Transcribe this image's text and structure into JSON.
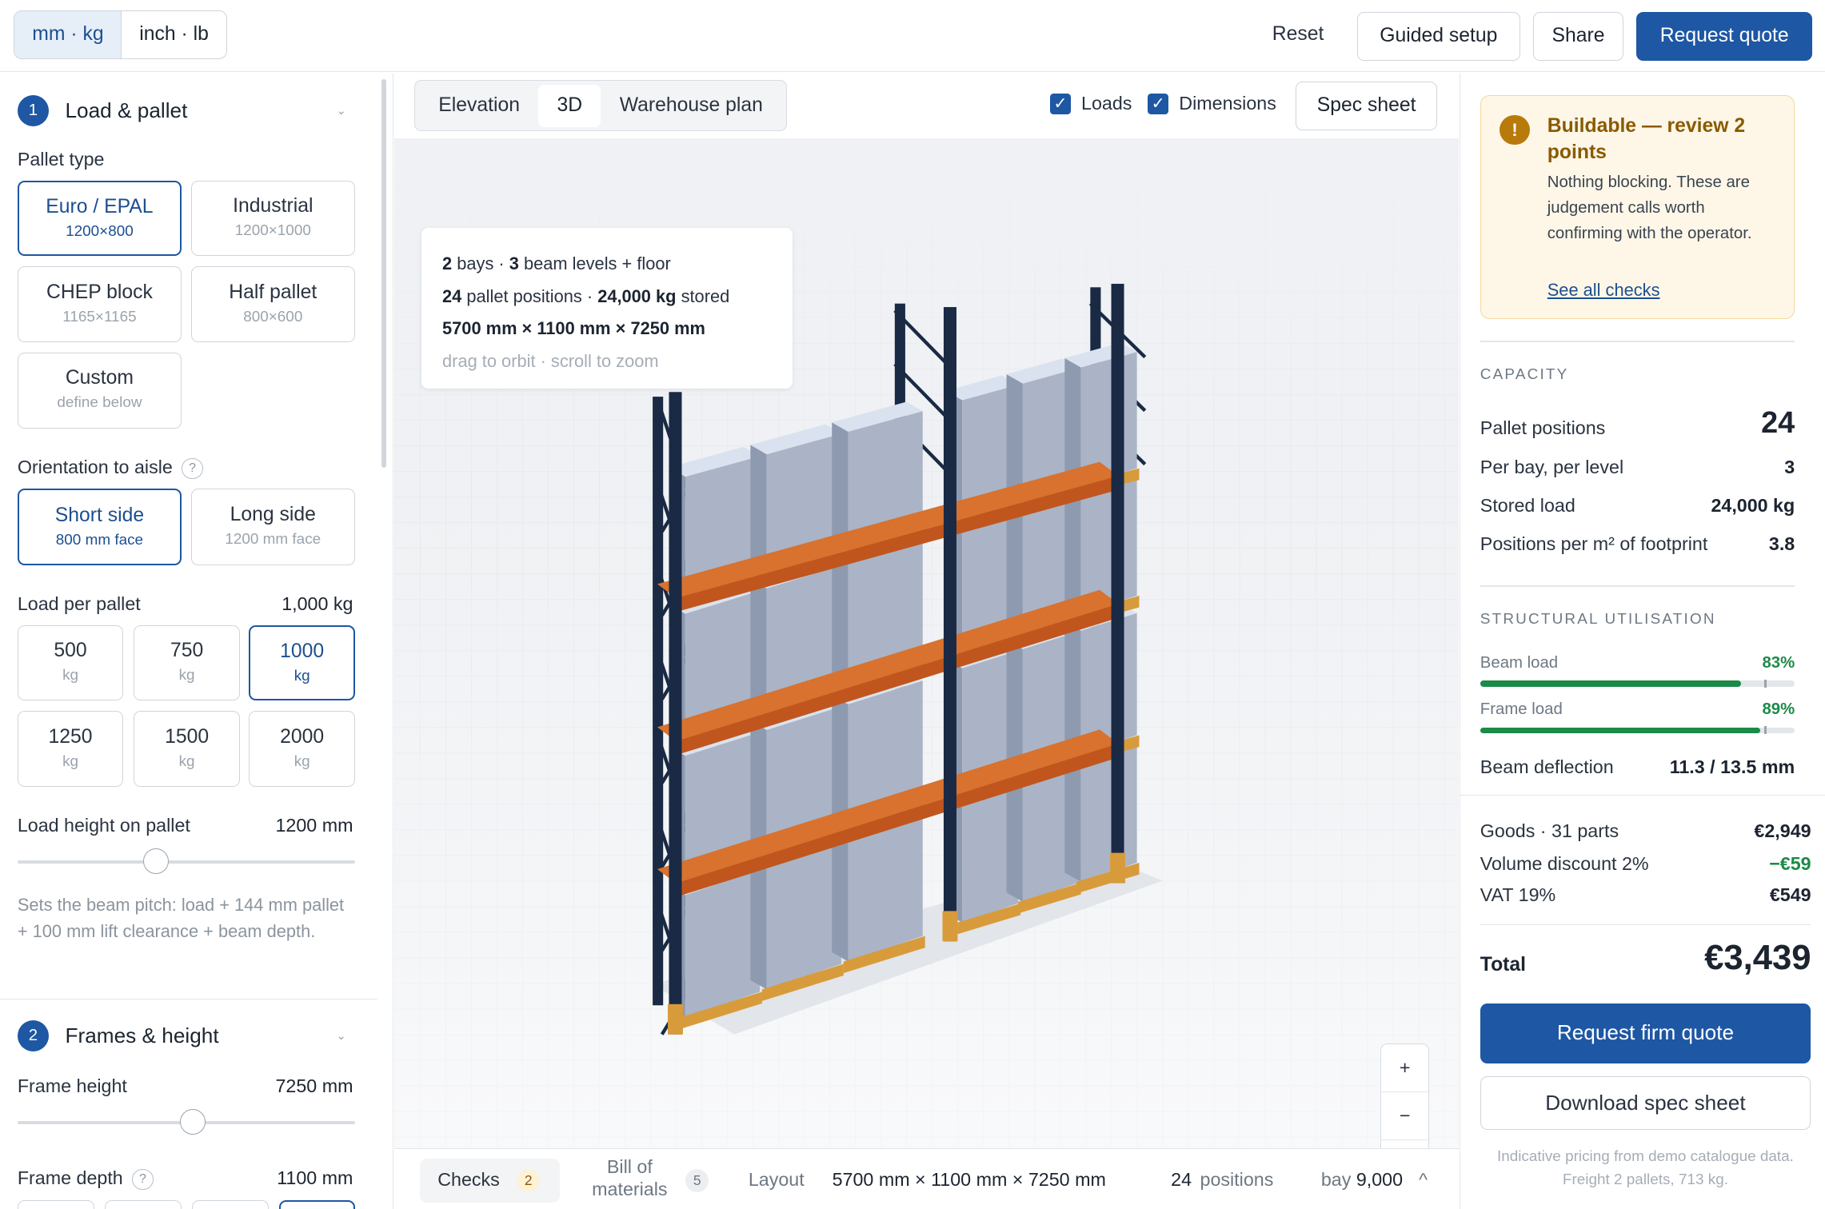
{
  "topbar": {
    "units": [
      "mm · kg",
      "inch · lb"
    ],
    "reset": "Reset",
    "guided": "Guided setup",
    "share": "Share",
    "quote": "Request quote"
  },
  "left": {
    "sec1": {
      "num": "1",
      "title": "Load & pallet"
    },
    "pallet_type_label": "Pallet type",
    "pallets": [
      {
        "title": "Euro / EPAL",
        "sub": "1200×800",
        "selected": true
      },
      {
        "title": "Industrial",
        "sub": "1200×1000"
      },
      {
        "title": "CHEP block",
        "sub": "1165×1165"
      },
      {
        "title": "Half pallet",
        "sub": "800×600"
      },
      {
        "title": "Custom",
        "sub": "define below"
      }
    ],
    "orientation_label": "Orientation to aisle",
    "help": "?",
    "orientations": [
      {
        "title": "Short side",
        "sub": "800 mm face",
        "selected": true
      },
      {
        "title": "Long side",
        "sub": "1200 mm face"
      }
    ],
    "load_label": "Load per pallet",
    "load_value": "1,000 kg",
    "loads": [
      {
        "v": "500",
        "u": "kg"
      },
      {
        "v": "750",
        "u": "kg"
      },
      {
        "v": "1000",
        "u": "kg",
        "selected": true
      },
      {
        "v": "1250",
        "u": "kg"
      },
      {
        "v": "1500",
        "u": "kg"
      },
      {
        "v": "2000",
        "u": "kg"
      }
    ],
    "height_label": "Load height on pallet",
    "height_value": "1200 mm",
    "height_slider": 0.41,
    "note": "Sets the beam pitch: load + 144 mm pallet + 100 mm lift clearance + beam depth.",
    "sec2": {
      "num": "2",
      "title": "Frames & height"
    },
    "frame_height_label": "Frame height",
    "frame_height_value": "7250 mm",
    "frame_slider": 0.52,
    "frame_depth_label": "Frame depth",
    "frame_depth_value": "1100 mm"
  },
  "center": {
    "views": [
      "Elevation",
      "3D",
      "Warehouse plan"
    ],
    "loads_check": "Loads",
    "dims_check": "Dimensions",
    "spec": "Spec sheet",
    "info": {
      "l1a": "2",
      "l1b": "bays · ",
      "l1c": "3",
      "l1d": "beam levels + floor",
      "l2a": "24",
      "l2b": "pallet positions · ",
      "l2c": "24,000 kg",
      "l2d": "stored",
      "l3": "5700 mm × 1100 mm × 7250 mm",
      "l4": "drag to orbit · scroll to zoom"
    },
    "zoom": [
      "+",
      "−",
      "⤢"
    ],
    "bottom": {
      "checks": "Checks",
      "checks_count": "2",
      "bom": "Bill of materials",
      "bom_count": "5",
      "layout": "Layout",
      "layout_dims": "5700 mm × 1100 mm × 7250 mm",
      "positions_n": "24",
      "positions": "positions",
      "bay": "bay",
      "bay_v": "9,000",
      "chevron": "^"
    }
  },
  "right": {
    "warn_icon": "!",
    "warn_title": "Buildable — review 2 points",
    "warn_body": "Nothing blocking. These are judgement calls worth confirming with the operator.",
    "warn_link": "See all checks",
    "capacity": "CAPACITY",
    "cap_rows": [
      {
        "l": "Pallet positions",
        "v": "24"
      },
      {
        "l": "Per bay, per level",
        "v": "3"
      },
      {
        "l": "Stored load",
        "v": "24,000 kg"
      },
      {
        "l": "Positions per m² of footprint",
        "v": "3.8"
      }
    ],
    "structural": "STRUCTURAL UTILISATION",
    "beam_load": "Beam load",
    "beam_pct": "83%",
    "beam_frac": 0.83,
    "frame_load": "Frame load",
    "frame_pct": "89%",
    "frame_frac": 0.89,
    "deflection_l": "Beam deflection",
    "deflection_v": "11.3 / 13.5 mm",
    "goods_l": "Goods · 31 parts",
    "goods_v": "€2,949",
    "disc_l": "Volume discount 2%",
    "disc_v": "−€59",
    "vat_l": "VAT 19%",
    "vat_v": "€549",
    "total_l": "Total",
    "total_v": "€3,439",
    "firm_quote": "Request firm quote",
    "download": "Download spec sheet",
    "footer": "Indicative pricing from demo catalogue data. Freight 2 pallets, 713 kg."
  },
  "colors": {
    "accent": "#1e57a3",
    "upright": "#1a2a44",
    "beam": "#c0561e",
    "load": "#aab4c6",
    "ok": "#1c8a48",
    "warn_bg": "#fef7e7"
  }
}
